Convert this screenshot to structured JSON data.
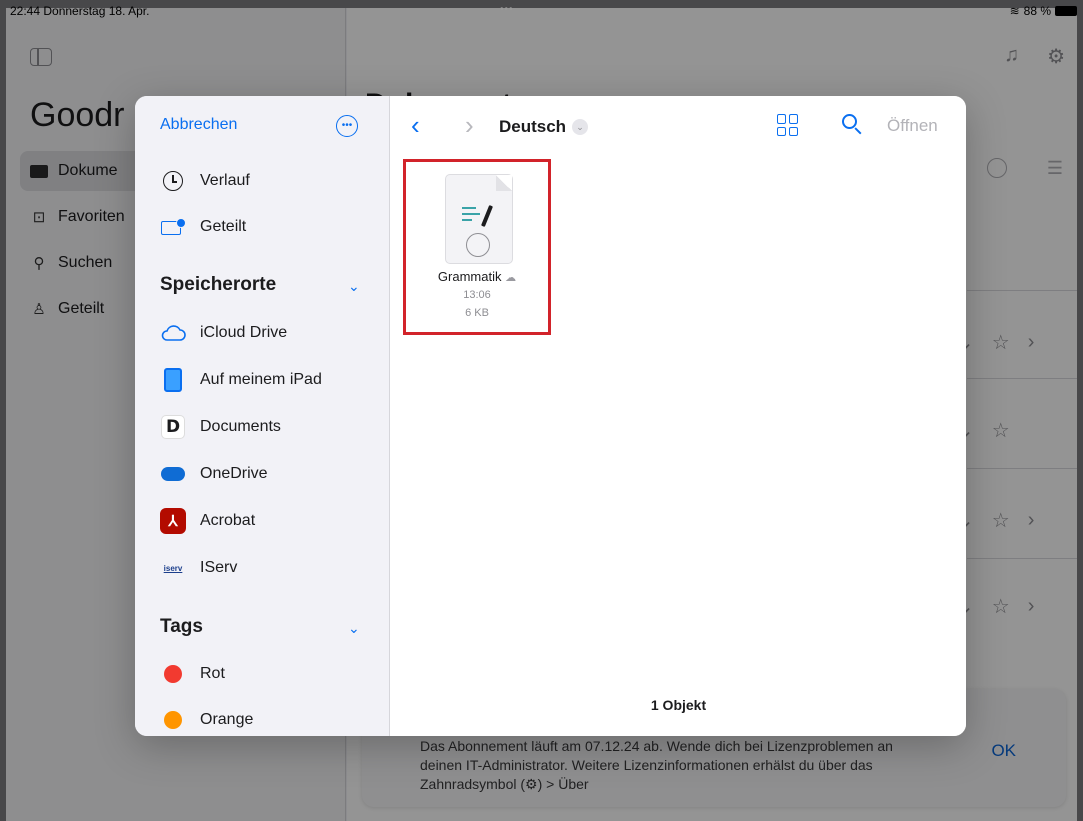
{
  "status_bar": {
    "time_date": "22:44  Donnerstag 18. Apr.",
    "dots": "•••",
    "battery": "88 %"
  },
  "background": {
    "sidebar_title": "Goodr",
    "nav": [
      {
        "label": "Dokume",
        "icon": "folder-icon"
      },
      {
        "label": "Favoriten",
        "icon": "bookmark-icon"
      },
      {
        "label": "Suchen",
        "icon": "search-icon"
      },
      {
        "label": "Geteilt",
        "icon": "people-icon"
      }
    ],
    "main_title": "Dokumente",
    "banner": {
      "text": "Das Abonnement läuft am 07.12.24 ab. Wende dich bei Lizenzproblemen an deinen IT-Administrator. Weitere Lizenzinformationen erhälst du über das Zahnradsymbol (⚙) > Über",
      "ok_label": "OK"
    }
  },
  "picker": {
    "cancel_label": "Abbrechen",
    "recents_label": "Verlauf",
    "shared_label": "Geteilt",
    "locations_header": "Speicherorte",
    "locations": [
      {
        "label": "iCloud Drive",
        "icon": "cloud-icon"
      },
      {
        "label": "Auf meinem iPad",
        "icon": "ipad-icon"
      },
      {
        "label": "Documents",
        "icon": "documents-app-icon"
      },
      {
        "label": "OneDrive",
        "icon": "onedrive-icon"
      },
      {
        "label": "Acrobat",
        "icon": "acrobat-icon"
      },
      {
        "label": "IServ",
        "icon": "iserv-icon"
      }
    ],
    "tags_header": "Tags",
    "tags": [
      {
        "label": "Rot",
        "color": "#f23a30"
      },
      {
        "label": "Orange",
        "color": "#ff9500"
      }
    ],
    "folder_title": "Deutsch",
    "open_label": "Öffnen",
    "file": {
      "name": "Grammatik",
      "time": "13:06",
      "size": "6 KB"
    },
    "item_count": "1 Objekt"
  },
  "colors": {
    "accent": "#0a6ff0",
    "highlight_frame": "#d2232a"
  }
}
